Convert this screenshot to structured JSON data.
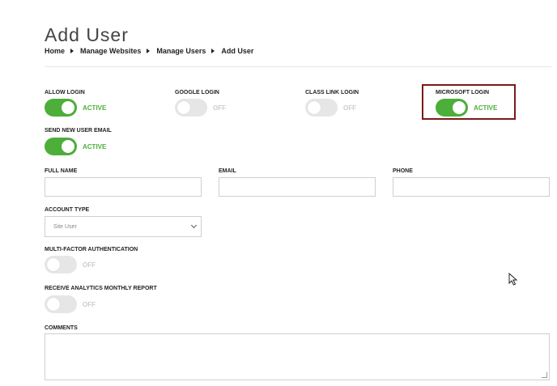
{
  "page": {
    "title": "Add User"
  },
  "breadcrumb": [
    "Home",
    "Manage Websites",
    "Manage Users",
    "Add User"
  ],
  "toggles": {
    "allow_login": {
      "label": "ALLOW LOGIN",
      "state": "ACTIVE",
      "on": true
    },
    "google_login": {
      "label": "GOOGLE LOGIN",
      "state": "OFF",
      "on": false
    },
    "class_link_login": {
      "label": "CLASS LINK LOGIN",
      "state": "OFF",
      "on": false
    },
    "microsoft_login": {
      "label": "MICROSOFT LOGIN",
      "state": "ACTIVE",
      "on": true
    },
    "send_new_user_email": {
      "label": "SEND NEW USER EMAIL",
      "state": "ACTIVE",
      "on": true
    },
    "mfa": {
      "label": "MULTI-FACTOR AUTHENTICATION",
      "state": "OFF",
      "on": false
    },
    "analytics_report": {
      "label": "RECEIVE ANALYTICS MONTHLY REPORT",
      "state": "OFF",
      "on": false
    }
  },
  "fields": {
    "full_name": {
      "label": "FULL NAME",
      "value": ""
    },
    "email": {
      "label": "EMAIL",
      "value": ""
    },
    "phone": {
      "label": "PHONE",
      "value": ""
    },
    "account_type": {
      "label": "ACCOUNT TYPE",
      "value": "Site User"
    },
    "comments": {
      "label": "COMMENTS",
      "value": ""
    }
  },
  "colors": {
    "accent": "#4caf3a",
    "highlight_border": "#7a1a1a",
    "off_track": "#e6e6e6"
  }
}
